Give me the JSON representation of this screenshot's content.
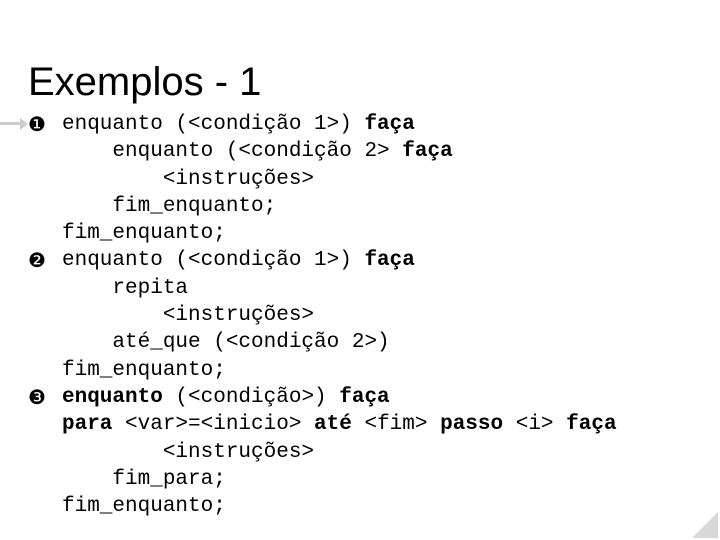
{
  "title": "Exemplos - 1",
  "bullets": [
    "❶",
    "❷",
    "❸"
  ],
  "code": {
    "b1": {
      "l1": {
        "plain": "enquanto (<condição 1>) ",
        "kw": "faça"
      },
      "l2": {
        "plain": "enquanto (<condição 2> ",
        "kw": "faça"
      },
      "l3": "<instruções>",
      "l4": "fim_enquanto;",
      "l5": "fim_enquanto;"
    },
    "b2": {
      "l1": {
        "plain": "enquanto (<condição 1>) ",
        "kw": "faça"
      },
      "l2": "repita",
      "l3": "<instruções>",
      "l4": "até_que (<condição 2>)",
      "l5": "fim_enquanto;"
    },
    "b3": {
      "l1": {
        "kw1": "enquanto ",
        "plain": "(<condição>) ",
        "kw2": "faça"
      },
      "l2a": "para ",
      "l2b": "<var>=<inicio> ",
      "l2c": "até ",
      "l2d": "<fim> ",
      "l2e": "passo ",
      "l2f": "<i> ",
      "l2g": "faça",
      "l3": "<instruções>",
      "l4": "fim_para;",
      "l5": "fim_enquanto;"
    }
  }
}
